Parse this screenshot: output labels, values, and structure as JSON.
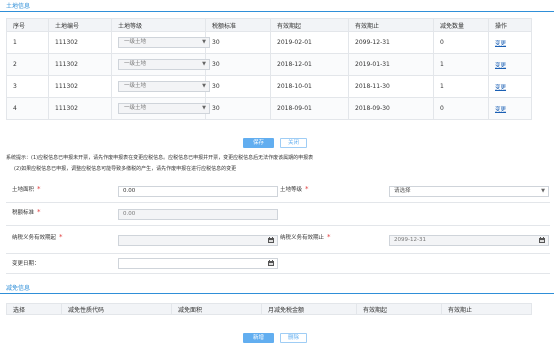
{
  "tabs": {
    "land_info": "土地信息"
  },
  "land_table": {
    "headers": [
      "序号",
      "土地编号",
      "土地等级",
      "税额标准",
      "有效期起",
      "有效期止",
      "减免数量",
      "操作"
    ],
    "rows": [
      {
        "index": "1",
        "land_no": "111302",
        "grade": "一级土地",
        "tax_std": "30",
        "start": "2019-02-01",
        "end": "2099-12-31",
        "relief_count": "0",
        "action": "变更"
      },
      {
        "index": "2",
        "land_no": "111302",
        "grade": "一级土地",
        "tax_std": "30",
        "start": "2018-12-01",
        "end": "2019-01-31",
        "relief_count": "1",
        "action": "变更"
      },
      {
        "index": "3",
        "land_no": "111302",
        "grade": "一级土地",
        "tax_std": "30",
        "start": "2018-10-01",
        "end": "2018-11-30",
        "relief_count": "1",
        "action": "变更"
      },
      {
        "index": "4",
        "land_no": "111302",
        "grade": "一级土地",
        "tax_std": "30",
        "start": "2018-09-01",
        "end": "2018-09-30",
        "relief_count": "0",
        "action": "变更"
      }
    ]
  },
  "buttons": {
    "save": "保存",
    "close": "关闭",
    "add": "新增",
    "delete": "删除"
  },
  "notice": {
    "line1": "系统提示：(1)应税信息已申报未开票，请先作废申报表在变更应税信息。应税信息已申报并开票，变更应税信息后无法作废该属期的申报表",
    "line2": "(2)如果应税信息已申报，调整应税信息可能导致多缴税的产生，请先作废申报在进行应税信息的变更"
  },
  "form": {
    "land_area_label": "土地面积",
    "land_area_value": "0.00",
    "land_grade_label": "土地等级",
    "land_grade_placeholder": "请选择",
    "tax_std_label": "税额标准",
    "tax_std_value": "0.00",
    "obligation_start_label": "纳税义务有效期起",
    "obligation_start_value": "",
    "obligation_end_label": "纳税义务有效期止",
    "obligation_end_value": "2099-12-31",
    "change_date_label": "变更日期：",
    "change_date_value": "",
    "required_mark": "*"
  },
  "relief": {
    "title": "减免信息",
    "headers": [
      "选择",
      "减免性质代码",
      "减免面积",
      "月减免税金额",
      "有效期起",
      "有效期止"
    ]
  },
  "colors": {
    "accent": "#2f8fd8",
    "button": "#62aef0",
    "required": "#e03b3b"
  }
}
